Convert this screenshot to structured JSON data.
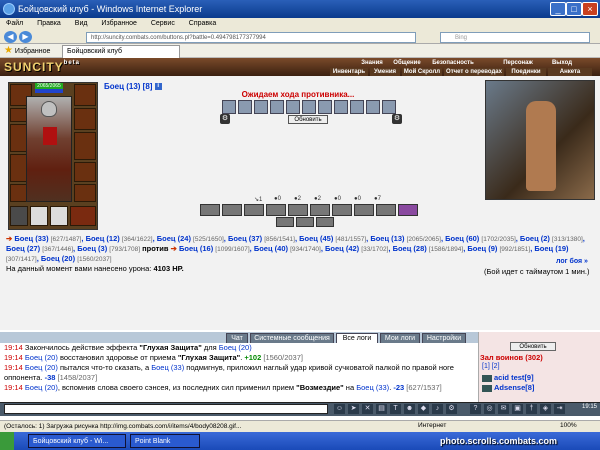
{
  "window": {
    "title": "Бойцовский клуб - Windows Internet Explorer"
  },
  "menu": {
    "items": [
      "Файл",
      "Правка",
      "Вид",
      "Избранное",
      "Сервис",
      "Справка"
    ]
  },
  "browser": {
    "address": "http://suncity.combats.com/buttons.pl?battle=0.494798177377994",
    "search_placeholder": "Bing",
    "favorites_label": "Избранное",
    "tab_title": "Бойцовский клуб"
  },
  "game_header": {
    "logo": "SUNCITY",
    "logo_badge": "beta",
    "nav": [
      "Знания",
      "Общение",
      "Безопасность",
      "Персонаж",
      "Выход"
    ],
    "subnav": [
      "Инвентарь",
      "Умения",
      "Мой Скролл",
      "Отчет о переводах",
      "Поединки",
      "Анкета"
    ]
  },
  "player": {
    "name": "Боец (13) [8]",
    "info_icon": "i",
    "hp_text": "2065/2065",
    "hp_fraction": 1.0,
    "mana_fraction": 1.0
  },
  "battle": {
    "waiting_text": "Ожидаем хода противника...",
    "refresh_label": "Обновить",
    "stats": [
      "1",
      "0",
      "2",
      "2",
      "0",
      "0",
      "7"
    ],
    "team1": [
      {
        "name": "Боец (33)",
        "hp": "[627/1487]"
      },
      {
        "name": "Боец (12)",
        "hp": "[364/1622]"
      },
      {
        "name": "Боец (24)",
        "hp": "[525/1650]"
      },
      {
        "name": "Боец (37)",
        "hp": "[856/1541]"
      },
      {
        "name": "Боец (45)",
        "hp": "[481/1557]"
      },
      {
        "name": "Боец (13)",
        "hp": "[2065/2065]"
      },
      {
        "name": "Боец (60)",
        "hp": "[1702/2035]"
      },
      {
        "name": "Боец (2)",
        "hp": "[313/1380]"
      },
      {
        "name": "Боец (27)",
        "hp": "[367/1446]"
      },
      {
        "name": "Боец (3)",
        "hp": "[793/1708]"
      }
    ],
    "versus_label": "против",
    "team2": [
      {
        "name": "Боец (16)",
        "hp": "[1099/1607]"
      },
      {
        "name": "Боец (40)",
        "hp": "[934/1740]"
      },
      {
        "name": "Боец (42)",
        "hp": "[33/1702]"
      },
      {
        "name": "Боец (28)",
        "hp": "[1586/1894]"
      },
      {
        "name": "Боец (9)",
        "hp": "[992/1851]"
      },
      {
        "name": "Боец (19)",
        "hp": "[307/1417]"
      },
      {
        "name": "Боец (20)",
        "hp": "[1560/2037]"
      }
    ],
    "damage_prefix": "На данный момент вами нанесено урона:",
    "damage_value": "4103 HP.",
    "log_link": "лог боя »",
    "timeout_text": "(Бой идет с таймаутом 1 мин.)"
  },
  "chat": {
    "tabs": [
      "Чат",
      "Системные сообщения",
      "Все логи",
      "Мои логи",
      "Настройки"
    ],
    "active_tab": "Все логи",
    "lines": [
      {
        "time": "19:14",
        "parts": [
          "Закончилось действие эффекта ",
          "\"Глухая Защита\"",
          " для ",
          "Боец (20)",
          ""
        ]
      },
      {
        "time": "19:14",
        "parts": [
          "",
          "Боец (20)",
          " восстановил здоровье от приема ",
          "\"Глухая Защита\"",
          ". ",
          "+102",
          " [1560/2037]"
        ]
      },
      {
        "time": "19:14",
        "parts": [
          "Боец (20)",
          " пытался что-то сказать, а ",
          "Боец (33)",
          " подмигнув, приложил наглый удар кривой сучковатой палкой по правой ноге оппонента. ",
          "-38",
          " [1458/2037]"
        ]
      },
      {
        "time": "19:14",
        "parts": [
          "Боец (20)",
          ", вспомнив слова своего сэнсея, из последних сил применил прием ",
          "\"Возмездие\"",
          " на ",
          "Боец (33)",
          ". ",
          "-23",
          " [627/1537]"
        ]
      }
    ]
  },
  "room": {
    "refresh_label": "Обновить",
    "title": "Зал воинов (302)",
    "pages": "[1] [2]",
    "users": [
      {
        "name": "acid test",
        "level": "[9]"
      },
      {
        "name": "Adsense",
        "level": "[8]"
      }
    ]
  },
  "toolbar": {
    "clock": "19:15"
  },
  "status": {
    "text": "(Осталось: 1) Загрузка рисунка http://img.combats.com/i/items/4/body08208.gif...",
    "zone": "Интернет",
    "zoom": "100%"
  },
  "taskbar": {
    "tasks": [
      "Бойцовский клуб - Wi...",
      "Point Blank"
    ],
    "watermark": "photo.scrolls.combats.com"
  },
  "colors": {
    "enemy_link": "#0033cc",
    "alert": "#cc0000",
    "heal": "#008800"
  }
}
